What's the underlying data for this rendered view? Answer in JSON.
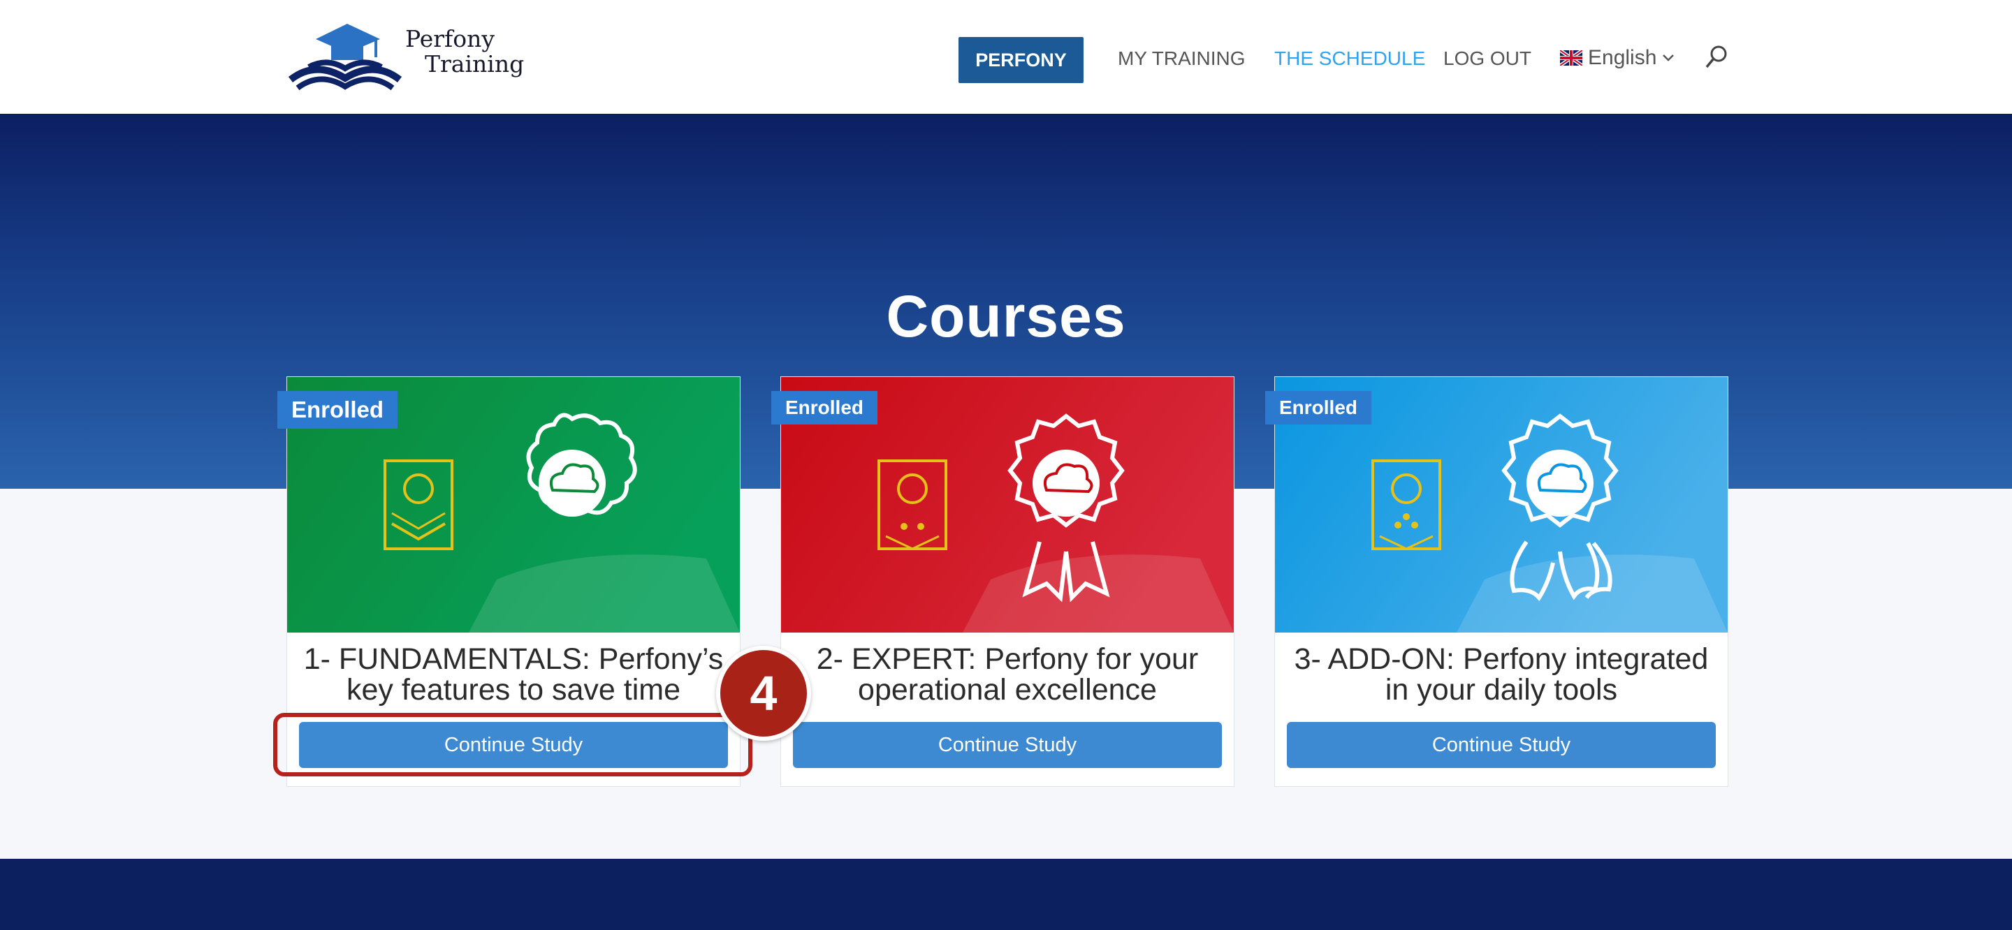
{
  "header": {
    "logo_line1": "Perfony",
    "logo_line2": "Training",
    "nav": {
      "perfony": "PERFONY",
      "my_training": "MY TRAINING",
      "schedule": "THE SCHEDULE",
      "logout": "LOG OUT",
      "language": "English"
    },
    "accent_color": "#2ea3f2",
    "primary_color": "#1c5a97"
  },
  "hero": {
    "title": "Courses"
  },
  "courses": [
    {
      "badge": "Enrolled",
      "title": "1- FUNDAMENTALS: Perfony’s key features to save time",
      "button": "Continue Study",
      "color": "#0a9a4a"
    },
    {
      "badge": "Enrolled",
      "title": "2- EXPERT: Perfony for your operational excellence",
      "button": "Continue Study",
      "color": "#d0101e"
    },
    {
      "badge": "Enrolled",
      "title": "3- ADD-ON: Perfony integrated in your daily tools",
      "button": "Continue Study",
      "color": "#1aa3e8"
    }
  ],
  "step_marker": "4"
}
